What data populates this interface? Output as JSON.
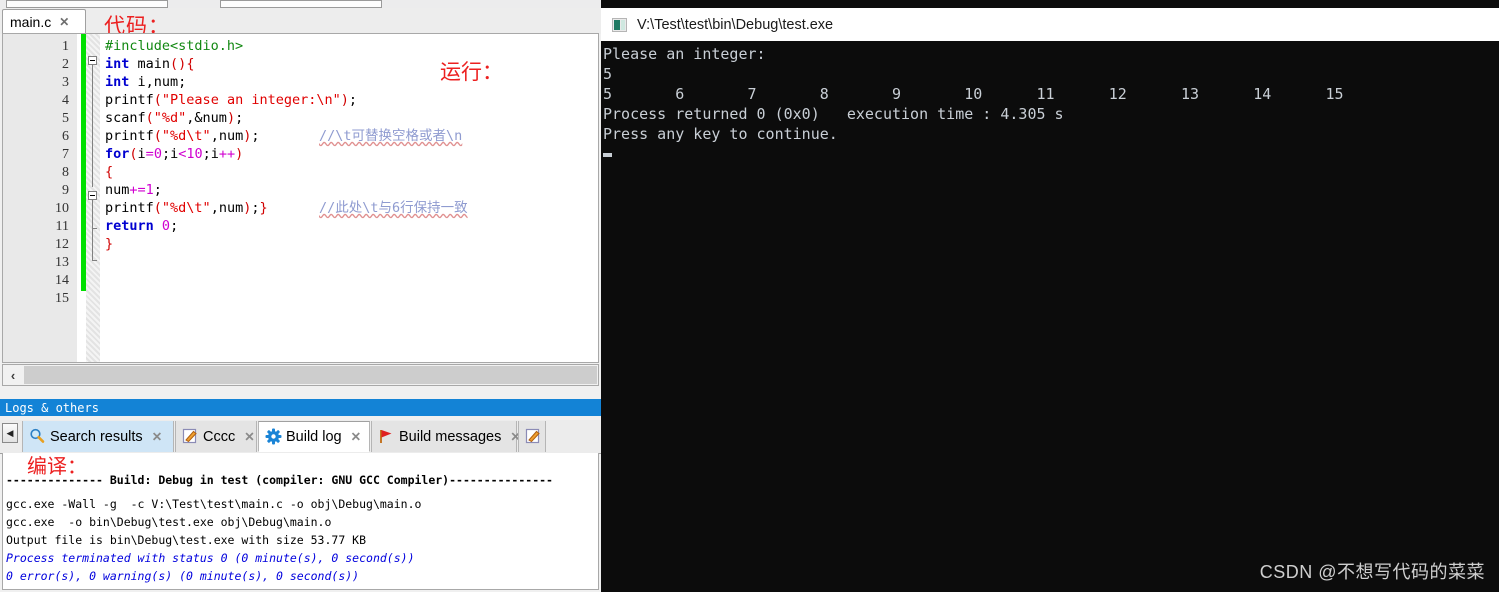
{
  "ide": {
    "editor_tab": {
      "label": "main.c",
      "close": "✕"
    },
    "annotation_code": "代码：",
    "annotation_run": "运行：",
    "annotation_compile": "编译：",
    "line_numbers": [
      "1",
      "2",
      "3",
      "4",
      "5",
      "6",
      "7",
      "8",
      "9",
      "10",
      "11",
      "12",
      "13",
      "14",
      "15"
    ],
    "code_lines": [
      "#include<stdio.h>",
      "int main(){",
      "int i,num;",
      "printf(\"Please an integer:\\n\");",
      "scanf(\"%d\",&num);",
      "printf(\"%d\\t\",num);",
      "for(i=0;i<10;i++)",
      "{",
      "num+=1;",
      "printf(\"%d\\t\",num);}",
      "return 0;",
      "}",
      "",
      "",
      ""
    ],
    "comments": {
      "line6": "//\\t可替换空格或者\\n",
      "line10": "//此处\\t与6行保持一致"
    },
    "scrollbar": {
      "left_arrow": "‹"
    },
    "logs_header": "Logs & others",
    "logs_tabs": [
      {
        "label": "Search results",
        "icon": "magnifier-icon",
        "close": "✕",
        "state": "active"
      },
      {
        "label": "Cccc",
        "icon": "pencil-icon",
        "close": "✕",
        "state": "normal"
      },
      {
        "label": "Build log",
        "icon": "gear-icon",
        "close": "✕",
        "state": "selected"
      },
      {
        "label": "Build messages",
        "icon": "flag-icon",
        "close": "✕",
        "state": "normal"
      },
      {
        "label": "",
        "icon": "pencil-icon",
        "close": "",
        "state": "normal"
      }
    ],
    "scroll_left_button": "◀",
    "build_log": [
      "-------------- Build: Debug in test (compiler: GNU GCC Compiler)---------------",
      "gcc.exe -Wall -g  -c V:\\Test\\test\\main.c -o obj\\Debug\\main.o",
      "gcc.exe  -o bin\\Debug\\test.exe obj\\Debug\\main.o",
      "Output file is bin\\Debug\\test.exe with size 53.77 KB",
      "Process terminated with status 0 (0 minute(s), 0 second(s))",
      "0 error(s), 0 warning(s) (0 minute(s), 0 second(s))"
    ]
  },
  "console": {
    "title": "V:\\Test\\test\\bin\\Debug\\test.exe",
    "icon": "console-window-icon",
    "lines": [
      "Please an integer:",
      "5",
      "5       6       7       8       9       10      11      12      13      14      15",
      "Process returned 0 (0x0)   execution time : 4.305 s",
      "Press any key to continue."
    ]
  },
  "watermark": "CSDN @不想写代码的菜菜",
  "colors": {
    "accent_blue": "#1383d6",
    "annotation_red": "#ec2020",
    "console_bg": "#0c0c0c",
    "console_fg": "#c9cfd6",
    "changebar_green": "#00e000"
  }
}
